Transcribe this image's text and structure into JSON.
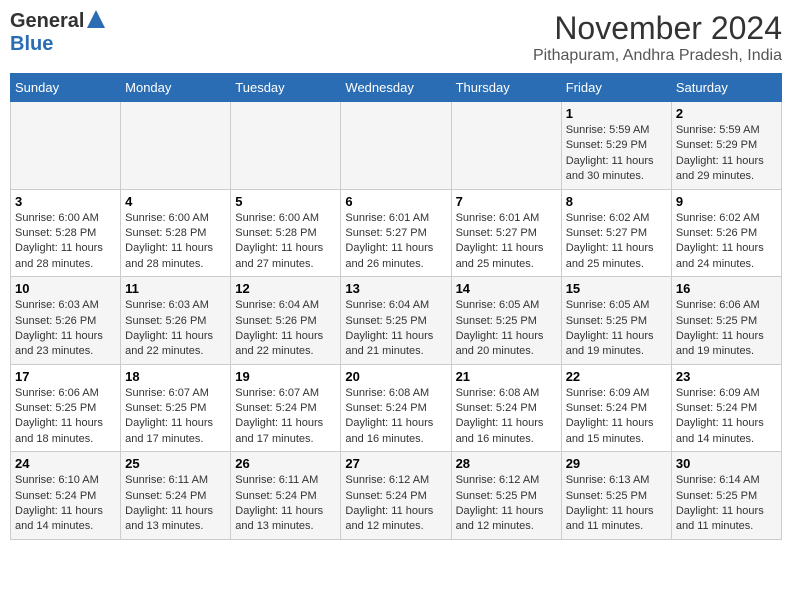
{
  "header": {
    "logo_general": "General",
    "logo_blue": "Blue",
    "month_title": "November 2024",
    "location": "Pithapuram, Andhra Pradesh, India"
  },
  "days_of_week": [
    "Sunday",
    "Monday",
    "Tuesday",
    "Wednesday",
    "Thursday",
    "Friday",
    "Saturday"
  ],
  "weeks": [
    {
      "days": [
        {
          "num": "",
          "info": ""
        },
        {
          "num": "",
          "info": ""
        },
        {
          "num": "",
          "info": ""
        },
        {
          "num": "",
          "info": ""
        },
        {
          "num": "",
          "info": ""
        },
        {
          "num": "1",
          "info": "Sunrise: 5:59 AM\nSunset: 5:29 PM\nDaylight: 11 hours and 30 minutes."
        },
        {
          "num": "2",
          "info": "Sunrise: 5:59 AM\nSunset: 5:29 PM\nDaylight: 11 hours and 29 minutes."
        }
      ]
    },
    {
      "days": [
        {
          "num": "3",
          "info": "Sunrise: 6:00 AM\nSunset: 5:28 PM\nDaylight: 11 hours and 28 minutes."
        },
        {
          "num": "4",
          "info": "Sunrise: 6:00 AM\nSunset: 5:28 PM\nDaylight: 11 hours and 28 minutes."
        },
        {
          "num": "5",
          "info": "Sunrise: 6:00 AM\nSunset: 5:28 PM\nDaylight: 11 hours and 27 minutes."
        },
        {
          "num": "6",
          "info": "Sunrise: 6:01 AM\nSunset: 5:27 PM\nDaylight: 11 hours and 26 minutes."
        },
        {
          "num": "7",
          "info": "Sunrise: 6:01 AM\nSunset: 5:27 PM\nDaylight: 11 hours and 25 minutes."
        },
        {
          "num": "8",
          "info": "Sunrise: 6:02 AM\nSunset: 5:27 PM\nDaylight: 11 hours and 25 minutes."
        },
        {
          "num": "9",
          "info": "Sunrise: 6:02 AM\nSunset: 5:26 PM\nDaylight: 11 hours and 24 minutes."
        }
      ]
    },
    {
      "days": [
        {
          "num": "10",
          "info": "Sunrise: 6:03 AM\nSunset: 5:26 PM\nDaylight: 11 hours and 23 minutes."
        },
        {
          "num": "11",
          "info": "Sunrise: 6:03 AM\nSunset: 5:26 PM\nDaylight: 11 hours and 22 minutes."
        },
        {
          "num": "12",
          "info": "Sunrise: 6:04 AM\nSunset: 5:26 PM\nDaylight: 11 hours and 22 minutes."
        },
        {
          "num": "13",
          "info": "Sunrise: 6:04 AM\nSunset: 5:25 PM\nDaylight: 11 hours and 21 minutes."
        },
        {
          "num": "14",
          "info": "Sunrise: 6:05 AM\nSunset: 5:25 PM\nDaylight: 11 hours and 20 minutes."
        },
        {
          "num": "15",
          "info": "Sunrise: 6:05 AM\nSunset: 5:25 PM\nDaylight: 11 hours and 19 minutes."
        },
        {
          "num": "16",
          "info": "Sunrise: 6:06 AM\nSunset: 5:25 PM\nDaylight: 11 hours and 19 minutes."
        }
      ]
    },
    {
      "days": [
        {
          "num": "17",
          "info": "Sunrise: 6:06 AM\nSunset: 5:25 PM\nDaylight: 11 hours and 18 minutes."
        },
        {
          "num": "18",
          "info": "Sunrise: 6:07 AM\nSunset: 5:25 PM\nDaylight: 11 hours and 17 minutes."
        },
        {
          "num": "19",
          "info": "Sunrise: 6:07 AM\nSunset: 5:24 PM\nDaylight: 11 hours and 17 minutes."
        },
        {
          "num": "20",
          "info": "Sunrise: 6:08 AM\nSunset: 5:24 PM\nDaylight: 11 hours and 16 minutes."
        },
        {
          "num": "21",
          "info": "Sunrise: 6:08 AM\nSunset: 5:24 PM\nDaylight: 11 hours and 16 minutes."
        },
        {
          "num": "22",
          "info": "Sunrise: 6:09 AM\nSunset: 5:24 PM\nDaylight: 11 hours and 15 minutes."
        },
        {
          "num": "23",
          "info": "Sunrise: 6:09 AM\nSunset: 5:24 PM\nDaylight: 11 hours and 14 minutes."
        }
      ]
    },
    {
      "days": [
        {
          "num": "24",
          "info": "Sunrise: 6:10 AM\nSunset: 5:24 PM\nDaylight: 11 hours and 14 minutes."
        },
        {
          "num": "25",
          "info": "Sunrise: 6:11 AM\nSunset: 5:24 PM\nDaylight: 11 hours and 13 minutes."
        },
        {
          "num": "26",
          "info": "Sunrise: 6:11 AM\nSunset: 5:24 PM\nDaylight: 11 hours and 13 minutes."
        },
        {
          "num": "27",
          "info": "Sunrise: 6:12 AM\nSunset: 5:24 PM\nDaylight: 11 hours and 12 minutes."
        },
        {
          "num": "28",
          "info": "Sunrise: 6:12 AM\nSunset: 5:25 PM\nDaylight: 11 hours and 12 minutes."
        },
        {
          "num": "29",
          "info": "Sunrise: 6:13 AM\nSunset: 5:25 PM\nDaylight: 11 hours and 11 minutes."
        },
        {
          "num": "30",
          "info": "Sunrise: 6:14 AM\nSunset: 5:25 PM\nDaylight: 11 hours and 11 minutes."
        }
      ]
    }
  ]
}
